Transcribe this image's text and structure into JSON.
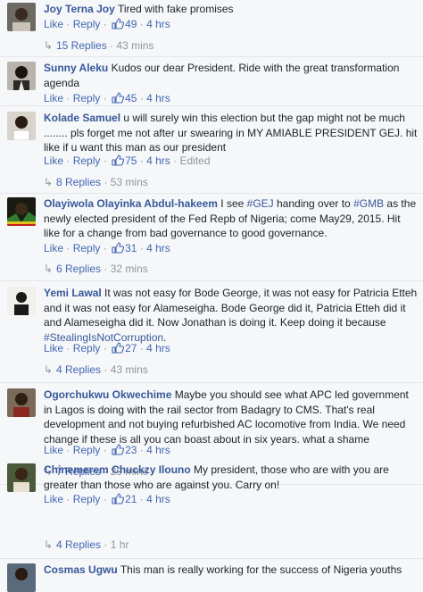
{
  "labels": {
    "like": "Like",
    "reply": "Reply",
    "dot": "·"
  },
  "comments": [
    {
      "author": "Joy Terna Joy",
      "text": "Tired with fake promises",
      "tags": [],
      "likes": "49",
      "time": "4 hrs",
      "edited": "",
      "replies": "15 Replies",
      "replies_time": "43 mins"
    },
    {
      "author": "Sunny Aleku",
      "text": "Kudos our dear President. Ride with the great transformation agenda",
      "likes": "45",
      "time": "4 hrs",
      "edited": "",
      "replies": "",
      "replies_time": ""
    },
    {
      "author": "Kolade Samuel",
      "text": "u will surely win this election but the gap might not be much ........ pls forget me not after ur swearing in MY AMIABLE PRESIDENT GEJ. hit like if u want this man as our president",
      "likes": "75",
      "time": "4 hrs",
      "edited": "Edited",
      "replies": "8 Replies",
      "replies_time": "53 mins"
    },
    {
      "author": "Olayiwola Olayinka Abdul-hakeem",
      "text_parts": [
        "I see ",
        "#GEJ",
        " handing over to ",
        "#GMB",
        " as the newly elected president of the Fed Repb of Nigeria; come May29, 2015. Hit like for a change from bad governance to good governance."
      ],
      "likes": "31",
      "time": "4 hrs",
      "edited": "",
      "replies": "6 Replies",
      "replies_time": "32 mins"
    },
    {
      "author": "Yemi Lawal",
      "text_parts": [
        "It was not easy for Bode George, it was not easy for Patricia Etteh and it was not easy for Alameseigha. Bode George did it, Patricia Etteh did it and Alameseigha did it. Now Jonathan is doing it. Keep doing it because ",
        "#StealingIsNotCorruption",
        "."
      ],
      "likes": "27",
      "time": "4 hrs",
      "edited": "",
      "replies": "4 Replies",
      "replies_time": "43 mins"
    },
    {
      "author": "Ogorchukwu Okwechime",
      "text": "Maybe you should see what APC led government in Lagos is doing with the rail sector from Badagry to CMS. That's real development and not buying refurbished AC locomotive from India. We need change if these is all you can boast about in six years. what a shame",
      "likes": "23",
      "time": "4 hrs",
      "edited": "",
      "replies": "7 Replies",
      "replies_time": "29 mins"
    },
    {
      "author": "Chinemerem Chuckzy Ilouno",
      "text": "My president, those who are with you are greater than those who are against you. Carry on!",
      "likes": "21",
      "time": "4 hrs",
      "edited": "",
      "replies": "4 Replies",
      "replies_time": "1 hr"
    },
    {
      "author": "Cosmas Ugwu",
      "text": "This man is really working for the success of Nigeria youths"
    }
  ]
}
